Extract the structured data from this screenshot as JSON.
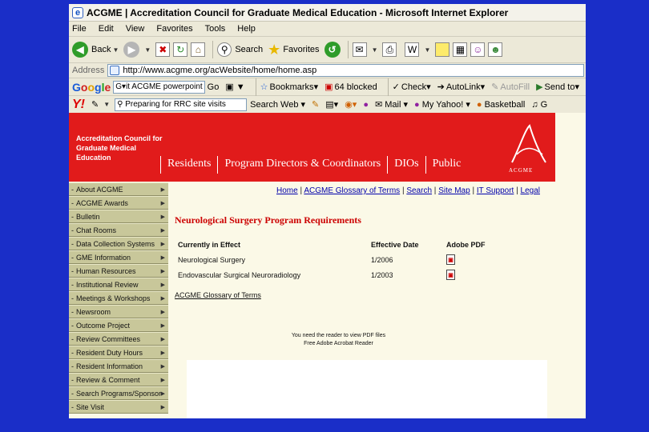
{
  "window": {
    "title": "ACGME | Accreditation Council for Graduate Medical Education - Microsoft Internet Explorer"
  },
  "menu": [
    "File",
    "Edit",
    "View",
    "Favorites",
    "Tools",
    "Help"
  ],
  "toolbar": {
    "back": "Back",
    "search": "Search",
    "favorites": "Favorites"
  },
  "address": {
    "label": "Address",
    "url": "http://www.acgme.org/acWebsite/home/home.asp"
  },
  "google_bar": {
    "logo": "Google",
    "query": "it ACGME powerpoint",
    "go": "Go",
    "bookmarks": "Bookmarks",
    "blocked": "64 blocked",
    "check": "Check",
    "autolink": "AutoLink",
    "autofill": "AutoFill",
    "sendto": "Send to"
  },
  "yahoo_bar": {
    "logo": "Y!",
    "query": "Preparing for RRC site visits",
    "search_web": "Search Web",
    "mail": "Mail",
    "my_yahoo": "My Yahoo!",
    "basketball": "Basketball",
    "more": "G"
  },
  "banner": {
    "org": "Accreditation Council for Graduate Medical Education",
    "nav": [
      "Residents",
      "Program Directors & Coordinators",
      "DIOs",
      "Public"
    ],
    "logo_text": "ACGME"
  },
  "sidebar": [
    "About ACGME",
    "ACGME Awards",
    "Bulletin",
    "Chat Rooms",
    "Data Collection Systems",
    "GME Information",
    "Human Resources",
    "Institutional Review",
    "Meetings & Workshops",
    "Newsroom",
    "Outcome Project",
    "Review Committees",
    "Resident Duty Hours",
    "Resident Information",
    "Review & Comment",
    "Search Programs/Sponsors",
    "Site Visit"
  ],
  "top_links": [
    "Home",
    "ACGME Glossary of Terms",
    "Search",
    "Site Map",
    "IT Support",
    "Legal"
  ],
  "heading": "Neurological Surgery Program Requirements",
  "table": {
    "headers": [
      "Currently in Effect",
      "Effective Date",
      "Adobe PDF"
    ],
    "rows": [
      {
        "name": "Neurological Surgery",
        "date": "1/2006"
      },
      {
        "name": "Endovascular Surgical Neuroradiology",
        "date": "1/2003"
      }
    ]
  },
  "glossary_link": "ACGME Glossary of Terms",
  "pdf_note": {
    "line1": "You need the reader to view PDF files",
    "line2": "Free Adobe Acrobat Reader"
  },
  "colors": {
    "banner": "#e11b1b",
    "sidebar": "#c8c79a",
    "content_bg": "#fbf9e7",
    "heading": "#cc0000",
    "desktop": "#1a2ec8"
  }
}
